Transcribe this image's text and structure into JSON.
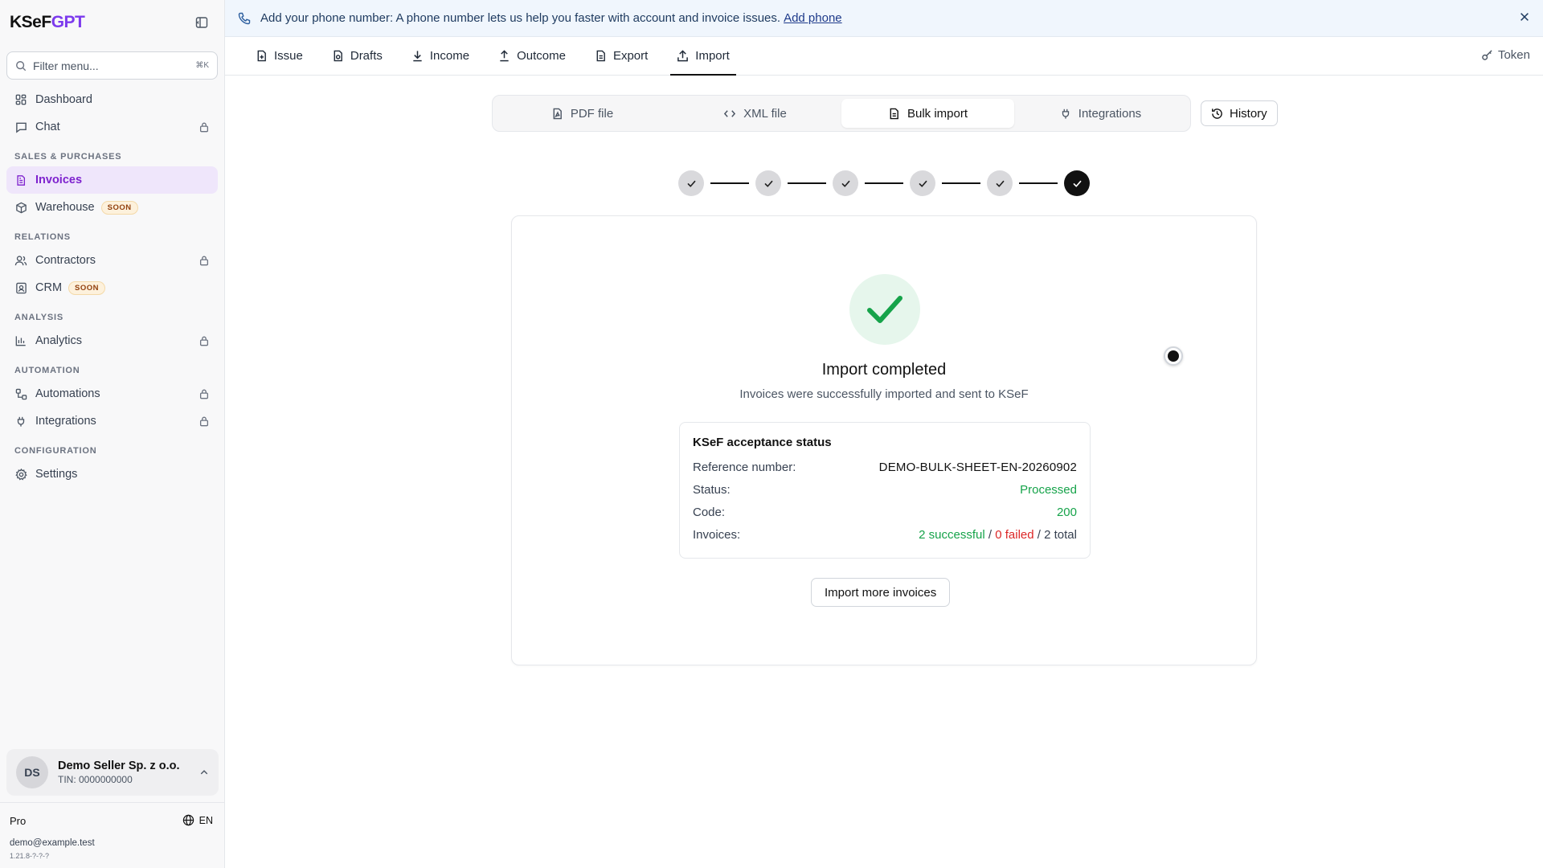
{
  "brand": {
    "prefix": "KSeF",
    "suffix": "GPT"
  },
  "sidebar": {
    "filter_placeholder": "Filter menu...",
    "filter_shortcut": "⌘K",
    "items_top": [
      {
        "label": "Dashboard",
        "icon": "dashboard-icon"
      },
      {
        "label": "Chat",
        "icon": "chat-icon",
        "locked": true
      }
    ],
    "sections": [
      {
        "title": "SALES & PURCHASES"
      },
      {
        "title": "RELATIONS"
      },
      {
        "title": "ANALYSIS"
      },
      {
        "title": "AUTOMATION"
      },
      {
        "title": "CONFIGURATION"
      }
    ],
    "invoices": "Invoices",
    "warehouse": "Warehouse",
    "soon": "SOON",
    "contractors": "Contractors",
    "crm": "CRM",
    "analytics": "Analytics",
    "automations": "Automations",
    "integrations": "Integrations",
    "settings": "Settings",
    "account": {
      "initials": "DS",
      "name": "Demo Seller Sp. z o.o.",
      "tin": "TIN: 0000000000"
    },
    "plan": "Pro",
    "language": "EN",
    "email": "demo@example.test",
    "version": "1.21.8-?-?-?"
  },
  "banner": {
    "text": "Add your phone number: A phone number lets us help you faster with account and invoice issues.",
    "link": "Add phone"
  },
  "tabs": [
    {
      "label": "Issue"
    },
    {
      "label": "Drafts"
    },
    {
      "label": "Income"
    },
    {
      "label": "Outcome"
    },
    {
      "label": "Export"
    },
    {
      "label": "Import",
      "active": true
    }
  ],
  "token_label": "Token",
  "segments": [
    {
      "label": "PDF file"
    },
    {
      "label": "XML file"
    },
    {
      "label": "Bulk import",
      "active": true
    },
    {
      "label": "Integrations"
    }
  ],
  "history_label": "History",
  "stepper": {
    "total_steps": 6,
    "current_step": 6
  },
  "result": {
    "title": "Import completed",
    "subtitle": "Invoices were successfully imported and sent to KSeF",
    "status_box": {
      "title": "KSeF acceptance status",
      "reference_label": "Reference number:",
      "reference_value": "DEMO-BULK-SHEET-EN-20260902",
      "status_label": "Status:",
      "status_value": "Processed",
      "code_label": "Code:",
      "code_value": "200",
      "invoices_label": "Invoices:",
      "successful": "2 successful",
      "sep1": " / ",
      "failed": "0 failed",
      "sep2": " / ",
      "total": "2 total"
    },
    "more_button": "Import more invoices"
  },
  "colors": {
    "accent": "#7c3aed",
    "success": "#16a34a",
    "danger": "#dc2626"
  }
}
